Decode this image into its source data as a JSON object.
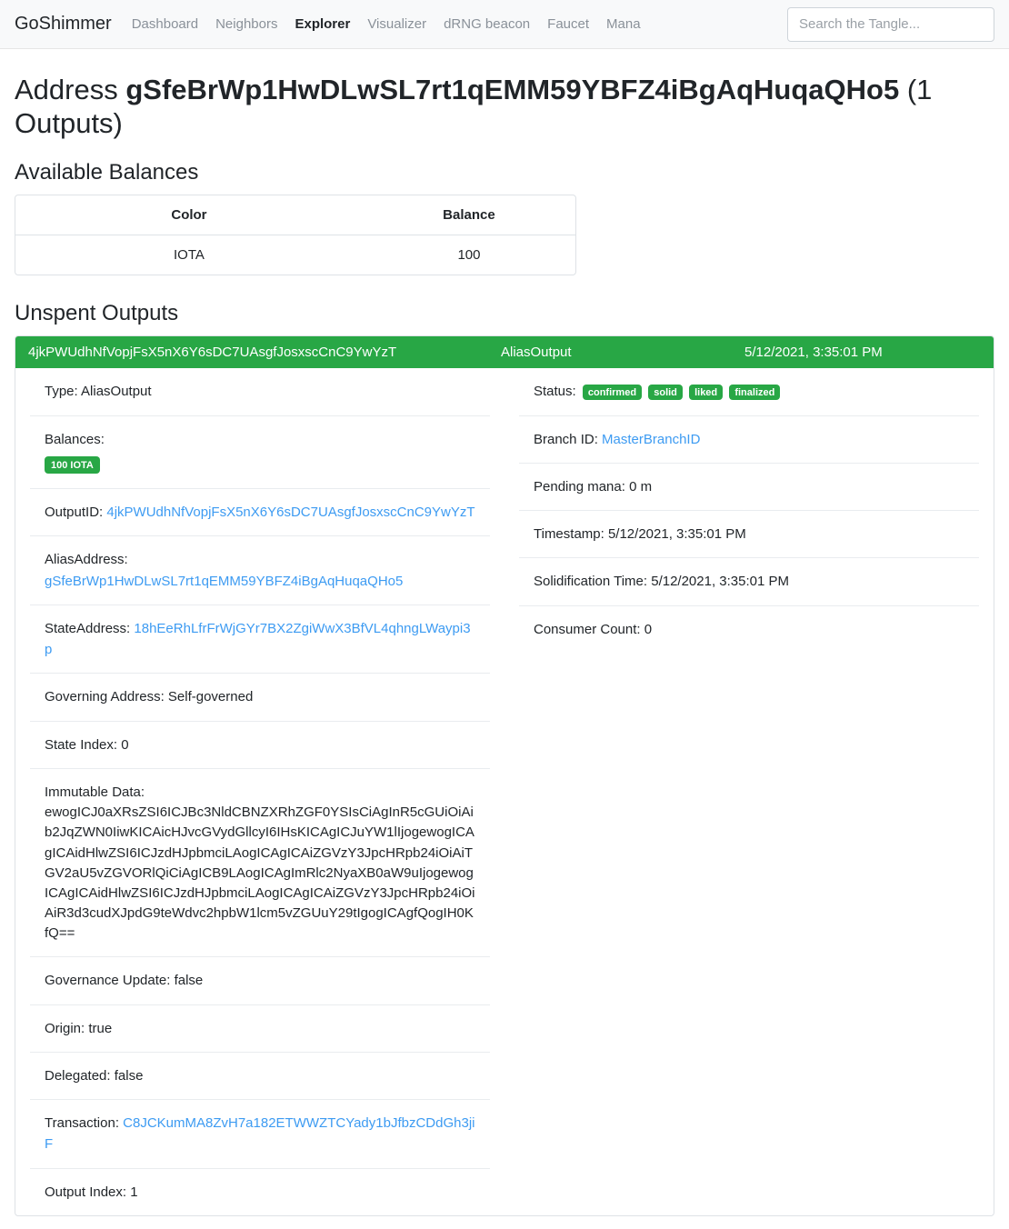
{
  "navbar": {
    "brand": "GoShimmer",
    "links": [
      {
        "label": "Dashboard",
        "active": false
      },
      {
        "label": "Neighbors",
        "active": false
      },
      {
        "label": "Explorer",
        "active": true
      },
      {
        "label": "Visualizer",
        "active": false
      },
      {
        "label": "dRNG beacon",
        "active": false
      },
      {
        "label": "Faucet",
        "active": false
      },
      {
        "label": "Mana",
        "active": false
      }
    ],
    "search_placeholder": "Search the Tangle...",
    "search_value": ""
  },
  "page": {
    "title_prefix": "Address",
    "address": "gSfeBrWp1HwDLwSL7rt1qEMM59YBFZ4iBgAqHuqaQHo5",
    "title_suffix": "(1 Outputs)"
  },
  "balances": {
    "heading": "Available Balances",
    "columns": [
      "Color",
      "Balance"
    ],
    "rows": [
      {
        "color": "IOTA",
        "balance": "100"
      }
    ]
  },
  "unspent_outputs": {
    "heading": "Unspent Outputs",
    "card": {
      "header": {
        "output_id": "4jkPWUdhNfVopjFsX5nX6Y6sDC7UAsgfJosxscCnC9YwYzT",
        "type": "AliasOutput",
        "timestamp": "5/12/2021, 3:35:01 PM"
      },
      "left": {
        "type_label": "Type: AliasOutput",
        "balances_label": "Balances:",
        "balance_badge": "100 IOTA",
        "output_id_label": "OutputID:",
        "output_id_value": "4jkPWUdhNfVopjFsX5nX6Y6sDC7UAsgfJosxscCnC9YwYzT",
        "alias_address_label": "AliasAddress:",
        "alias_address_value": "gSfeBrWp1HwDLwSL7rt1qEMM59YBFZ4iBgAqHuqaQHo5",
        "state_address_label": "StateAddress:",
        "state_address_value": "18hEeRhLfrFrWjGYr7BX2ZgiWwX3BfVL4qhngLWaypi3p",
        "governing_address": "Governing Address: Self-governed",
        "state_index": "State Index: 0",
        "immutable_data_label": "Immutable Data:",
        "immutable_data_value": "ewogICJ0aXRsZSI6ICJBc3NldCBNZXRhZGF0YSIsCiAgInR5cGUiOiAib2JqZWN0IiwKICAicHJvcGVydGllcyI6IHsKICAgICJuYW1lIjogewogICAgICAidHlwZSI6ICJzdHJpbmciLAogICAgICAiZGVzY3JpcHRpb24iOiAiTGV2aU5vZGVORlQiCiAgICB9LAogICAgImRlc2NyaXB0aW9uIjogewogICAgICAidHlwZSI6ICJzdHJpbmciLAogICAgICAiZGVzY3JpcHRpb24iOiAiR3d3cudXJpdG9teWdvc2hpbW1lcm5vZGUuY29tIgogICAgfQogIH0KfQ==",
        "governance_update": "Governance Update: false",
        "origin": "Origin: true",
        "delegated": "Delegated: false",
        "transaction_label": "Transaction:",
        "transaction_value": "C8JCKumMA8ZvH7a182ETWWZTCYady1bJfbzCDdGh3jiF",
        "output_index": "Output Index: 1"
      },
      "right": {
        "status_label": "Status:",
        "status_badges": [
          "confirmed",
          "solid",
          "liked",
          "finalized"
        ],
        "branch_id_label": "Branch ID:",
        "branch_id_value": "MasterBranchID",
        "pending_mana": "Pending mana: 0 m",
        "timestamp": "Timestamp: 5/12/2021, 3:35:01 PM",
        "solidification_time": "Solidification Time: 5/12/2021, 3:35:01 PM",
        "consumer_count": "Consumer Count: 0"
      }
    }
  },
  "colors": {
    "success_green": "#28a745",
    "link_blue": "#3d9bf2",
    "navbar_bg": "#f8f9fa"
  }
}
